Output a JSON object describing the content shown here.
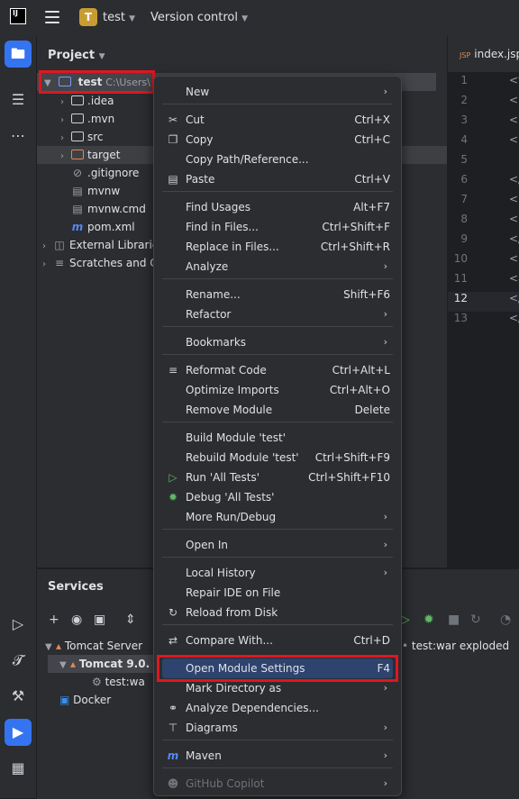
{
  "titlebar": {
    "logo_text": "IJ",
    "project_badge": "T",
    "project_name": "test",
    "version_control": "Version control"
  },
  "project_panel": {
    "title": "Project",
    "root": {
      "name": "test",
      "path": "C:\\Users\\"
    },
    "items": [
      {
        "label": ".idea",
        "kind": "folder"
      },
      {
        "label": ".mvn",
        "kind": "folder"
      },
      {
        "label": "src",
        "kind": "folder"
      },
      {
        "label": "target",
        "kind": "folder-excluded"
      },
      {
        "label": ".gitignore",
        "kind": "ignore-file"
      },
      {
        "label": "mvnw",
        "kind": "script-file"
      },
      {
        "label": "mvnw.cmd",
        "kind": "script-file"
      },
      {
        "label": "pom.xml",
        "kind": "maven-file"
      },
      {
        "label": "External Libraries",
        "kind": "libraries"
      },
      {
        "label": "Scratches and C",
        "kind": "scratches"
      }
    ]
  },
  "editor": {
    "tab_badge": "JSP",
    "tab_label": "index.jsp",
    "line_numbers": [
      "1",
      "2",
      "3",
      "4",
      "5",
      "6",
      "7",
      "8",
      "9",
      "10",
      "11",
      "12",
      "13"
    ],
    "current_line": "12",
    "code_fragments": [
      "<%",
      "<!",
      "<h",
      "<h",
      "",
      "</",
      "<b",
      "<h",
      "</",
      "<b",
      "<a",
      "</",
      "</"
    ]
  },
  "services": {
    "title": "Services",
    "tree": {
      "server": "Tomcat Server",
      "instance": "Tomcat 9.0.",
      "artifact": "test:wa",
      "docker": "Docker"
    },
    "log_line": "test:war exploded"
  },
  "context_menu": {
    "items": [
      {
        "label": "New",
        "shortcut": "",
        "submenu": true,
        "icon": ""
      },
      {
        "label": "Cut",
        "shortcut": "Ctrl+X",
        "submenu": false,
        "icon": "scissors-icon"
      },
      {
        "label": "Copy",
        "shortcut": "Ctrl+C",
        "submenu": false,
        "icon": "copy-icon"
      },
      {
        "label": "Copy Path/Reference...",
        "shortcut": "",
        "submenu": false,
        "icon": ""
      },
      {
        "label": "Paste",
        "shortcut": "Ctrl+V",
        "submenu": false,
        "icon": "paste-icon"
      },
      {
        "label": "Find Usages",
        "shortcut": "Alt+F7",
        "submenu": false,
        "icon": ""
      },
      {
        "label": "Find in Files...",
        "shortcut": "Ctrl+Shift+F",
        "submenu": false,
        "icon": ""
      },
      {
        "label": "Replace in Files...",
        "shortcut": "Ctrl+Shift+R",
        "submenu": false,
        "icon": ""
      },
      {
        "label": "Analyze",
        "shortcut": "",
        "submenu": true,
        "icon": ""
      },
      {
        "label": "Rename...",
        "shortcut": "Shift+F6",
        "submenu": false,
        "icon": ""
      },
      {
        "label": "Refactor",
        "shortcut": "",
        "submenu": true,
        "icon": ""
      },
      {
        "label": "Bookmarks",
        "shortcut": "",
        "submenu": true,
        "icon": ""
      },
      {
        "label": "Reformat Code",
        "shortcut": "Ctrl+Alt+L",
        "submenu": false,
        "icon": "reformat-icon"
      },
      {
        "label": "Optimize Imports",
        "shortcut": "Ctrl+Alt+O",
        "submenu": false,
        "icon": ""
      },
      {
        "label": "Remove Module",
        "shortcut": "Delete",
        "submenu": false,
        "icon": ""
      },
      {
        "label": "Build Module 'test'",
        "shortcut": "",
        "submenu": false,
        "icon": ""
      },
      {
        "label": "Rebuild Module 'test'",
        "shortcut": "Ctrl+Shift+F9",
        "submenu": false,
        "icon": ""
      },
      {
        "label": "Run 'All Tests'",
        "shortcut": "Ctrl+Shift+F10",
        "submenu": false,
        "icon": "run-icon"
      },
      {
        "label": "Debug 'All Tests'",
        "shortcut": "",
        "submenu": false,
        "icon": "debug-icon"
      },
      {
        "label": "More Run/Debug",
        "shortcut": "",
        "submenu": true,
        "icon": ""
      },
      {
        "label": "Open In",
        "shortcut": "",
        "submenu": true,
        "icon": ""
      },
      {
        "label": "Local History",
        "shortcut": "",
        "submenu": true,
        "icon": ""
      },
      {
        "label": "Repair IDE on File",
        "shortcut": "",
        "submenu": false,
        "icon": ""
      },
      {
        "label": "Reload from Disk",
        "shortcut": "",
        "submenu": false,
        "icon": "reload-icon"
      },
      {
        "label": "Compare With...",
        "shortcut": "Ctrl+D",
        "submenu": false,
        "icon": "compare-icon"
      },
      {
        "label": "Open Module Settings",
        "shortcut": "F4",
        "submenu": false,
        "icon": ""
      },
      {
        "label": "Mark Directory as",
        "shortcut": "",
        "submenu": true,
        "icon": ""
      },
      {
        "label": "Analyze Dependencies...",
        "shortcut": "",
        "submenu": false,
        "icon": "dependencies-icon"
      },
      {
        "label": "Diagrams",
        "shortcut": "",
        "submenu": true,
        "icon": "diagrams-icon"
      },
      {
        "label": "Maven",
        "shortcut": "",
        "submenu": true,
        "icon": "maven-icon"
      },
      {
        "label": "GitHub Copilot",
        "shortcut": "",
        "submenu": true,
        "icon": "copilot-icon"
      }
    ]
  },
  "colors": {
    "accent": "#3574f0",
    "highlight": "#2e436e",
    "annotation_red": "#e0161f",
    "project_badge": "#c79d33"
  }
}
